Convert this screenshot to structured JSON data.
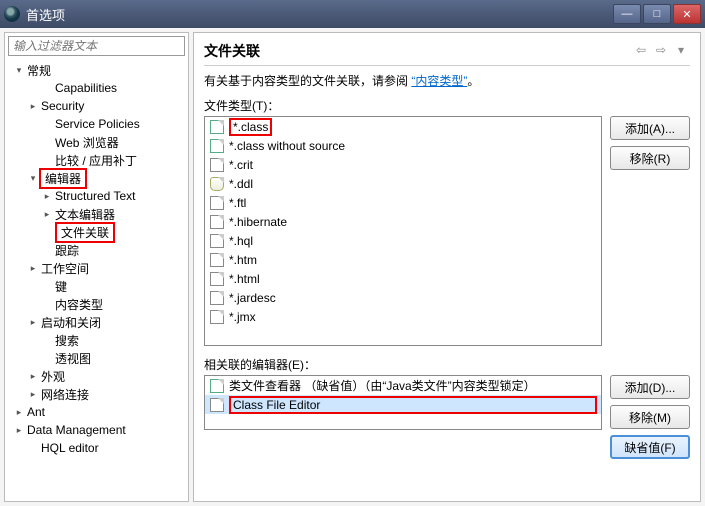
{
  "window": {
    "title": "首选项"
  },
  "filter": {
    "placeholder": "输入过滤器文本"
  },
  "tree": {
    "general": "常规",
    "capabilities": "Capabilities",
    "security": "Security",
    "service_policies": "Service Policies",
    "web_browser": "Web 浏览器",
    "compare_patch": "比较 / 应用补丁",
    "editors": "编辑器",
    "structured_text": "Structured Text",
    "text_editors": "文本编辑器",
    "file_assoc": "文件关联",
    "trace": "跟踪",
    "workspace": "工作空间",
    "keys": "键",
    "content_types": "内容类型",
    "startup_shutdown": "启动和关闭",
    "search": "搜索",
    "perspectives": "透视图",
    "appearance": "外观",
    "network": "网络连接",
    "ant": "Ant",
    "data_mgmt": "Data Management",
    "hql": "HQL editor"
  },
  "header": {
    "title": "文件关联"
  },
  "desc": {
    "text": "有关基于内容类型的文件关联，请参阅",
    "link": "“内容类型”",
    "tail": "。"
  },
  "labels": {
    "file_types": "文件类型(T)：",
    "associated_editors": "相关联的编辑器(E)："
  },
  "file_types": [
    {
      "ext": "*.class",
      "icon": "j",
      "hl": true
    },
    {
      "ext": "*.class without source",
      "icon": "j"
    },
    {
      "ext": "*.crit",
      "icon": "q"
    },
    {
      "ext": "*.ddl",
      "icon": "db"
    },
    {
      "ext": "*.ftl",
      "icon": "f"
    },
    {
      "ext": "*.hibernate",
      "icon": "c"
    },
    {
      "ext": "*.hql",
      "icon": "q"
    },
    {
      "ext": "*.htm",
      "icon": "h"
    },
    {
      "ext": "*.html",
      "icon": "h"
    },
    {
      "ext": "*.jardesc",
      "icon": "jar"
    },
    {
      "ext": "*.jmx",
      "icon": "f"
    }
  ],
  "editors": [
    {
      "label": "类文件查看器 （缺省值）（由“Java类文件”内容类型锁定）",
      "icon": "j"
    },
    {
      "label": "Class File Editor",
      "icon": "c",
      "sel": true,
      "hl": true
    }
  ],
  "buttons": {
    "add_a": "添加(A)...",
    "remove_r": "移除(R)",
    "add_d": "添加(D)...",
    "remove_m": "移除(M)",
    "default_f": "缺省值(F)"
  }
}
